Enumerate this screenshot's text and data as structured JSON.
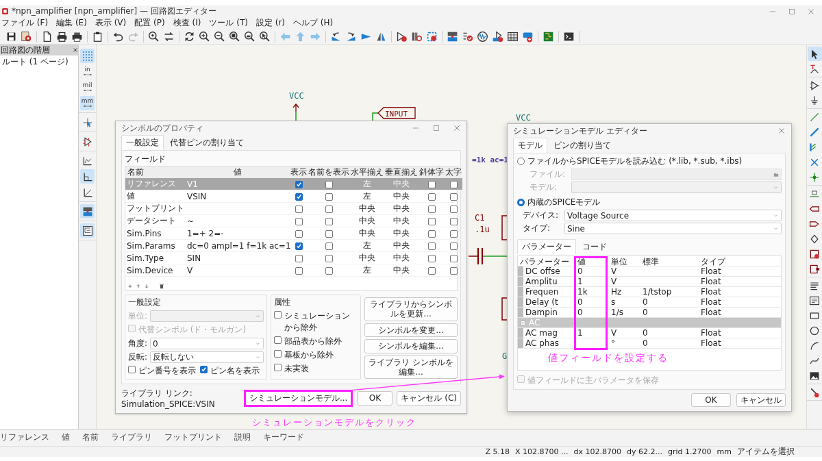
{
  "window": {
    "title": "*npn_amplifier [npn_amplifier] — 回路図エディター"
  },
  "menu": [
    "ファイル (F)",
    "編集 (E)",
    "表示 (V)",
    "配置 (P)",
    "検査 (I)",
    "ツール (T)",
    "設定 (r)",
    "ヘルプ (H)"
  ],
  "toolbar": [
    {
      "items": [
        {
          "kind": "save",
          "disabled": false
        },
        {
          "kind": "sheet_gear",
          "disabled": false
        }
      ]
    },
    {
      "items": [
        {
          "kind": "page",
          "disabled": false
        },
        {
          "kind": "print",
          "disabled": false
        },
        {
          "kind": "plot",
          "disabled": false
        }
      ]
    },
    {
      "items": [
        {
          "kind": "clipboard",
          "disabled": false
        }
      ]
    },
    {
      "items": [
        {
          "kind": "undo",
          "disabled": false
        },
        {
          "kind": "redo",
          "disabled": true
        }
      ]
    },
    {
      "items": [
        {
          "kind": "find",
          "disabled": false
        },
        {
          "kind": "replace",
          "disabled": false
        }
      ]
    },
    {
      "items": [
        {
          "kind": "refresh",
          "disabled": false
        },
        {
          "kind": "zoom_in",
          "disabled": false
        },
        {
          "kind": "zoom_out",
          "disabled": false
        },
        {
          "kind": "zoom_fit",
          "disabled": false
        },
        {
          "kind": "zoom_page",
          "disabled": false
        },
        {
          "kind": "zoom_sel",
          "disabled": false
        }
      ]
    },
    {
      "items": [
        {
          "kind": "arrow_left",
          "disabled": false
        },
        {
          "kind": "arrow_up",
          "disabled": false
        },
        {
          "kind": "arrow_right",
          "disabled": false
        }
      ]
    },
    {
      "items": [
        {
          "kind": "rot_ccw",
          "disabled": false
        },
        {
          "kind": "rot_cw",
          "disabled": false
        },
        {
          "kind": "flip",
          "disabled": false
        },
        {
          "kind": "mirror",
          "disabled": false
        }
      ]
    },
    {
      "items": [
        {
          "kind": "sym_edit",
          "disabled": false
        },
        {
          "kind": "libbrowse",
          "disabled": false
        },
        {
          "kind": "fpassign",
          "disabled": false
        }
      ]
    },
    {
      "items": [
        {
          "kind": "annotate",
          "disabled": false
        },
        {
          "kind": "erc",
          "disabled": false
        },
        {
          "kind": "sim",
          "disabled": false
        },
        {
          "kind": "sym_fields",
          "disabled": false
        },
        {
          "kind": "table",
          "disabled": false
        },
        {
          "kind": "bom",
          "disabled": false
        }
      ]
    },
    {
      "items": [
        {
          "kind": "pcb",
          "disabled": false
        }
      ]
    },
    {
      "items": [
        {
          "kind": "terminal",
          "disabled": false
        }
      ]
    }
  ],
  "hierarchy": {
    "title": "回路図の階層",
    "items": [
      {
        "label": "ルート (1 ページ)"
      }
    ]
  },
  "left_toolbar": [
    {
      "items": [
        {
          "kind": "grid",
          "selected": true
        },
        {
          "kind": "unit",
          "label": "in",
          "selected": false
        },
        {
          "kind": "unit",
          "label": "mil",
          "selected": false
        },
        {
          "kind": "unit",
          "label": "mm",
          "selected": true
        }
      ]
    },
    {
      "items": [
        {
          "kind": "cursor",
          "selected": false
        }
      ]
    },
    {
      "items": [
        {
          "kind": "pins",
          "selected": false
        }
      ]
    },
    {
      "items": [
        {
          "kind": "line_free",
          "selected": false
        },
        {
          "kind": "line_90",
          "selected": true
        },
        {
          "kind": "line_45",
          "selected": false
        }
      ]
    },
    {
      "items": [
        {
          "kind": "annotate",
          "selected": true
        }
      ]
    },
    {
      "items": [
        {
          "kind": "hierarchy",
          "selected": true
        }
      ]
    }
  ],
  "right_toolbar": [
    {
      "items": [
        {
          "kind": "pointer",
          "selected": true
        },
        {
          "kind": "probe",
          "selected": false
        }
      ]
    },
    {
      "items": [
        {
          "kind": "symbol",
          "selected": false
        },
        {
          "kind": "ground",
          "selected": false
        }
      ]
    },
    {
      "items": [
        {
          "kind": "wire",
          "selected": false
        },
        {
          "kind": "bus",
          "selected": false
        },
        {
          "kind": "bus_entry",
          "selected": false
        },
        {
          "kind": "no_connect",
          "selected": false
        },
        {
          "kind": "junction",
          "selected": false
        }
      ]
    },
    {
      "items": [
        {
          "kind": "label",
          "selected": false
        },
        {
          "kind": "global_label",
          "selected": false
        },
        {
          "kind": "hier_label",
          "selected": false
        },
        {
          "kind": "directive",
          "selected": false
        },
        {
          "kind": "sheet",
          "selected": false
        },
        {
          "kind": "sheet_pin",
          "selected": false
        }
      ]
    },
    {
      "items": [
        {
          "kind": "text",
          "selected": false
        },
        {
          "kind": "textbox",
          "selected": false
        },
        {
          "kind": "rect",
          "selected": false
        },
        {
          "kind": "circle",
          "selected": false
        },
        {
          "kind": "arc",
          "selected": false
        },
        {
          "kind": "bezier",
          "selected": false
        },
        {
          "kind": "image",
          "selected": false
        }
      ]
    },
    {
      "items": [
        {
          "kind": "delete",
          "selected": false
        }
      ]
    }
  ],
  "canvas": {
    "power_1": "VCC",
    "net_label": "INPUT",
    "power_2": "VCC",
    "sim_params": "=1k ac=1",
    "c1_ref": "C1",
    "c1_value": ".1u",
    "gnd_power": "G"
  },
  "properties_panel": {
    "columns": [
      "リファレンス",
      "値",
      "名前",
      "ライブラリ",
      "フットプリント",
      "説明",
      "キーワード"
    ]
  },
  "status_bar": [
    "Z 5.18",
    "X 102.8700 ...",
    "dx 102.8700",
    "dy 62.2...",
    "grid 1.2700",
    "mm",
    "アイテムを選択"
  ],
  "symbol_dialog": {
    "title": "シンボルのプロパティ",
    "tabs": [
      {
        "label": "一般設定",
        "selected": true
      },
      {
        "label": "代替ピンの割り当て",
        "selected": false
      }
    ],
    "fields_group": "フィールド",
    "columns": [
      "名前",
      "値",
      "表示",
      "名前を表示",
      "水平揃え",
      "垂直揃え",
      "斜体字",
      "太字"
    ],
    "rows": [
      {
        "name": "リファレンス",
        "value": "V1",
        "show": true,
        "show_name": false,
        "h_align": "左",
        "v_align": "中央",
        "italic": false,
        "bold": false,
        "selected": true
      },
      {
        "name": "値",
        "value": "VSIN",
        "show": true,
        "show_name": false,
        "h_align": "左",
        "v_align": "中央",
        "italic": false,
        "bold": false,
        "selected": false
      },
      {
        "name": "フットプリント",
        "show": false,
        "show_name": false,
        "h_align": "中央",
        "v_align": "中央",
        "italic": false,
        "bold": false,
        "selected": false
      },
      {
        "name": "データシート",
        "value": "~",
        "show": false,
        "show_name": false,
        "h_align": "中央",
        "v_align": "中央",
        "italic": false,
        "bold": false,
        "selected": false
      },
      {
        "name": "Sim.Pins",
        "value": "1=+ 2=-",
        "show": false,
        "show_name": false,
        "h_align": "中央",
        "v_align": "中央",
        "italic": false,
        "bold": false,
        "selected": false
      },
      {
        "name": "Sim.Params",
        "value": "dc=0 ampl=1 f=1k ac=1",
        "show": true,
        "show_name": false,
        "h_align": "左",
        "v_align": "中央",
        "italic": false,
        "bold": false,
        "selected": false
      },
      {
        "name": "Sim.Type",
        "value": "SIN",
        "show": false,
        "show_name": false,
        "h_align": "中央",
        "v_align": "中央",
        "italic": false,
        "bold": false,
        "selected": false
      },
      {
        "name": "Sim.Device",
        "value": "V",
        "show": false,
        "show_name": false,
        "h_align": "左",
        "v_align": "中央",
        "italic": false,
        "bold": false,
        "selected": false
      }
    ],
    "general": {
      "title": "一般設定",
      "unit": {
        "label": "単位:",
        "disabled": true
      },
      "alt_symbol": {
        "label": "代替シンボル (ド・モルガン)",
        "checked": false,
        "disabled": true
      },
      "angle": {
        "label": "角度:",
        "value": "0"
      },
      "mirror": {
        "label": "反転:",
        "value": "反転しない"
      },
      "show_pin_numbers": {
        "label": "ピン番号を表示",
        "checked": false
      },
      "show_pin_names": {
        "label": "ピン名を表示",
        "checked": true
      }
    },
    "attributes": {
      "title": "属性",
      "items": [
        {
          "label": "シミュレーションから除外",
          "checked": false
        },
        {
          "label": "部品表から除外",
          "checked": false
        },
        {
          "label": "基板から除外",
          "checked": false
        },
        {
          "label": "未実装",
          "checked": false
        }
      ]
    },
    "actions": [
      "ライブラリからシンボルを更新...",
      "シンボルを変更...",
      "シンボルを編集...",
      "ライブラリ シンボルを編集..."
    ],
    "library_link": "ライブラリ リンク: Simulation_SPICE:VSIN",
    "buttons": [
      "シミュレーションモデル...",
      "OK",
      "キャンセル (C)"
    ]
  },
  "sim_dialog": {
    "title": "シミュレーションモデル エディター",
    "tabs": [
      {
        "label": "モデル",
        "selected": true
      },
      {
        "label": "ピンの割り当て",
        "selected": false
      }
    ],
    "source_options": [
      {
        "label": "ファイルからSPICEモデルを読み込む (*.lib, *.sub, *.ibs)",
        "selected": false
      },
      {
        "label": "内蔵のSPICEモデル",
        "selected": true
      }
    ],
    "file": {
      "label": "ファイル:",
      "disabled": true
    },
    "model": {
      "label": "モデル:",
      "disabled": true
    },
    "device": {
      "label": "デバイス:",
      "value": "Voltage Source"
    },
    "type": {
      "label": "タイプ:",
      "value": "Sine"
    },
    "sub_tabs": [
      {
        "label": "パラメーター",
        "selected": true
      },
      {
        "label": "コード",
        "selected": false
      }
    ],
    "columns": [
      "パラメーター",
      "値",
      "単位",
      "標準",
      "タイプ"
    ],
    "groups": [
      {
        "rows": [
          {
            "name": "DC offse",
            "value": "0",
            "unit": "V",
            "type": "Float"
          },
          {
            "name": "Amplitu",
            "value": "1",
            "unit": "V",
            "type": "Float"
          },
          {
            "name": "Frequen",
            "value": "1k",
            "unit": "Hz",
            "default": "1/tstop",
            "type": "Float"
          },
          {
            "name": "Delay (t",
            "value": "0",
            "unit": "s",
            "default": "0",
            "type": "Float"
          },
          {
            "name": "Dampin",
            "value": "0",
            "unit": "1/s",
            "default": "0",
            "type": "Float"
          }
        ]
      },
      {
        "label": "AC",
        "expanded": true,
        "rows": [
          {
            "name": "AC mag",
            "value": "1",
            "unit": "V",
            "default": "0",
            "type": "Float"
          },
          {
            "name": "AC phas",
            "unit": "°",
            "default": "0",
            "type": "Float"
          }
        ]
      }
    ],
    "save_checkbox": {
      "label": "値フィールドに主パラメータを保存",
      "checked": false,
      "disabled": true
    },
    "buttons": [
      "OK",
      "キャンセル"
    ]
  },
  "annotations": {
    "click_note": "シミュレーションモデルをクリック",
    "value_note": "値フィールドを設定する"
  }
}
